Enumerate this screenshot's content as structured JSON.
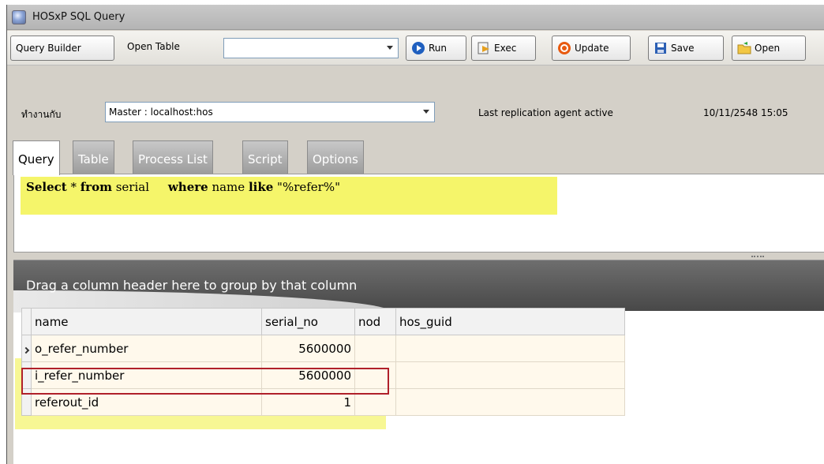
{
  "window": {
    "title": "HOSxP SQL Query"
  },
  "toolbar": {
    "query_builder": "Query Builder",
    "open_table_label": "Open Table",
    "open_table_value": "",
    "run": "Run",
    "exec": "Exec",
    "update": "Update",
    "save": "Save",
    "open": "Open"
  },
  "connection": {
    "work_label": "ทำงานกับ",
    "server_value": "Master : localhost:hos",
    "status": "Last replication agent active",
    "timestamp": "10/11/2548 15:05"
  },
  "tabs": [
    "Query",
    "Table",
    "Process List",
    "Script",
    "Options"
  ],
  "editor": {
    "tokens": [
      {
        "t": "Select",
        "kw": true
      },
      {
        "t": " * "
      },
      {
        "t": "from",
        "kw": true
      },
      {
        "t": " serial     "
      },
      {
        "t": "where",
        "kw": true
      },
      {
        "t": " name "
      },
      {
        "t": "like",
        "kw": true
      },
      {
        "t": " \"%refer%\""
      }
    ]
  },
  "grid": {
    "group_hint": "Drag a column header here to group by that column",
    "columns": [
      "name",
      "serial_no",
      "nod",
      "hos_guid"
    ],
    "rows": [
      {
        "name": "o_refer_number",
        "serial_no": "5600000"
      },
      {
        "name": "i_refer_number",
        "serial_no": "5600000"
      },
      {
        "name": "referout_id",
        "serial_no": "1"
      }
    ]
  },
  "colors": {
    "highlight": "#f5f56a",
    "selection_border": "#b0202a"
  },
  "icons": [
    "app-icon",
    "run-icon",
    "exec-icon",
    "update-icon",
    "save-icon",
    "open-folder-icon",
    "row-pointer-icon"
  ]
}
